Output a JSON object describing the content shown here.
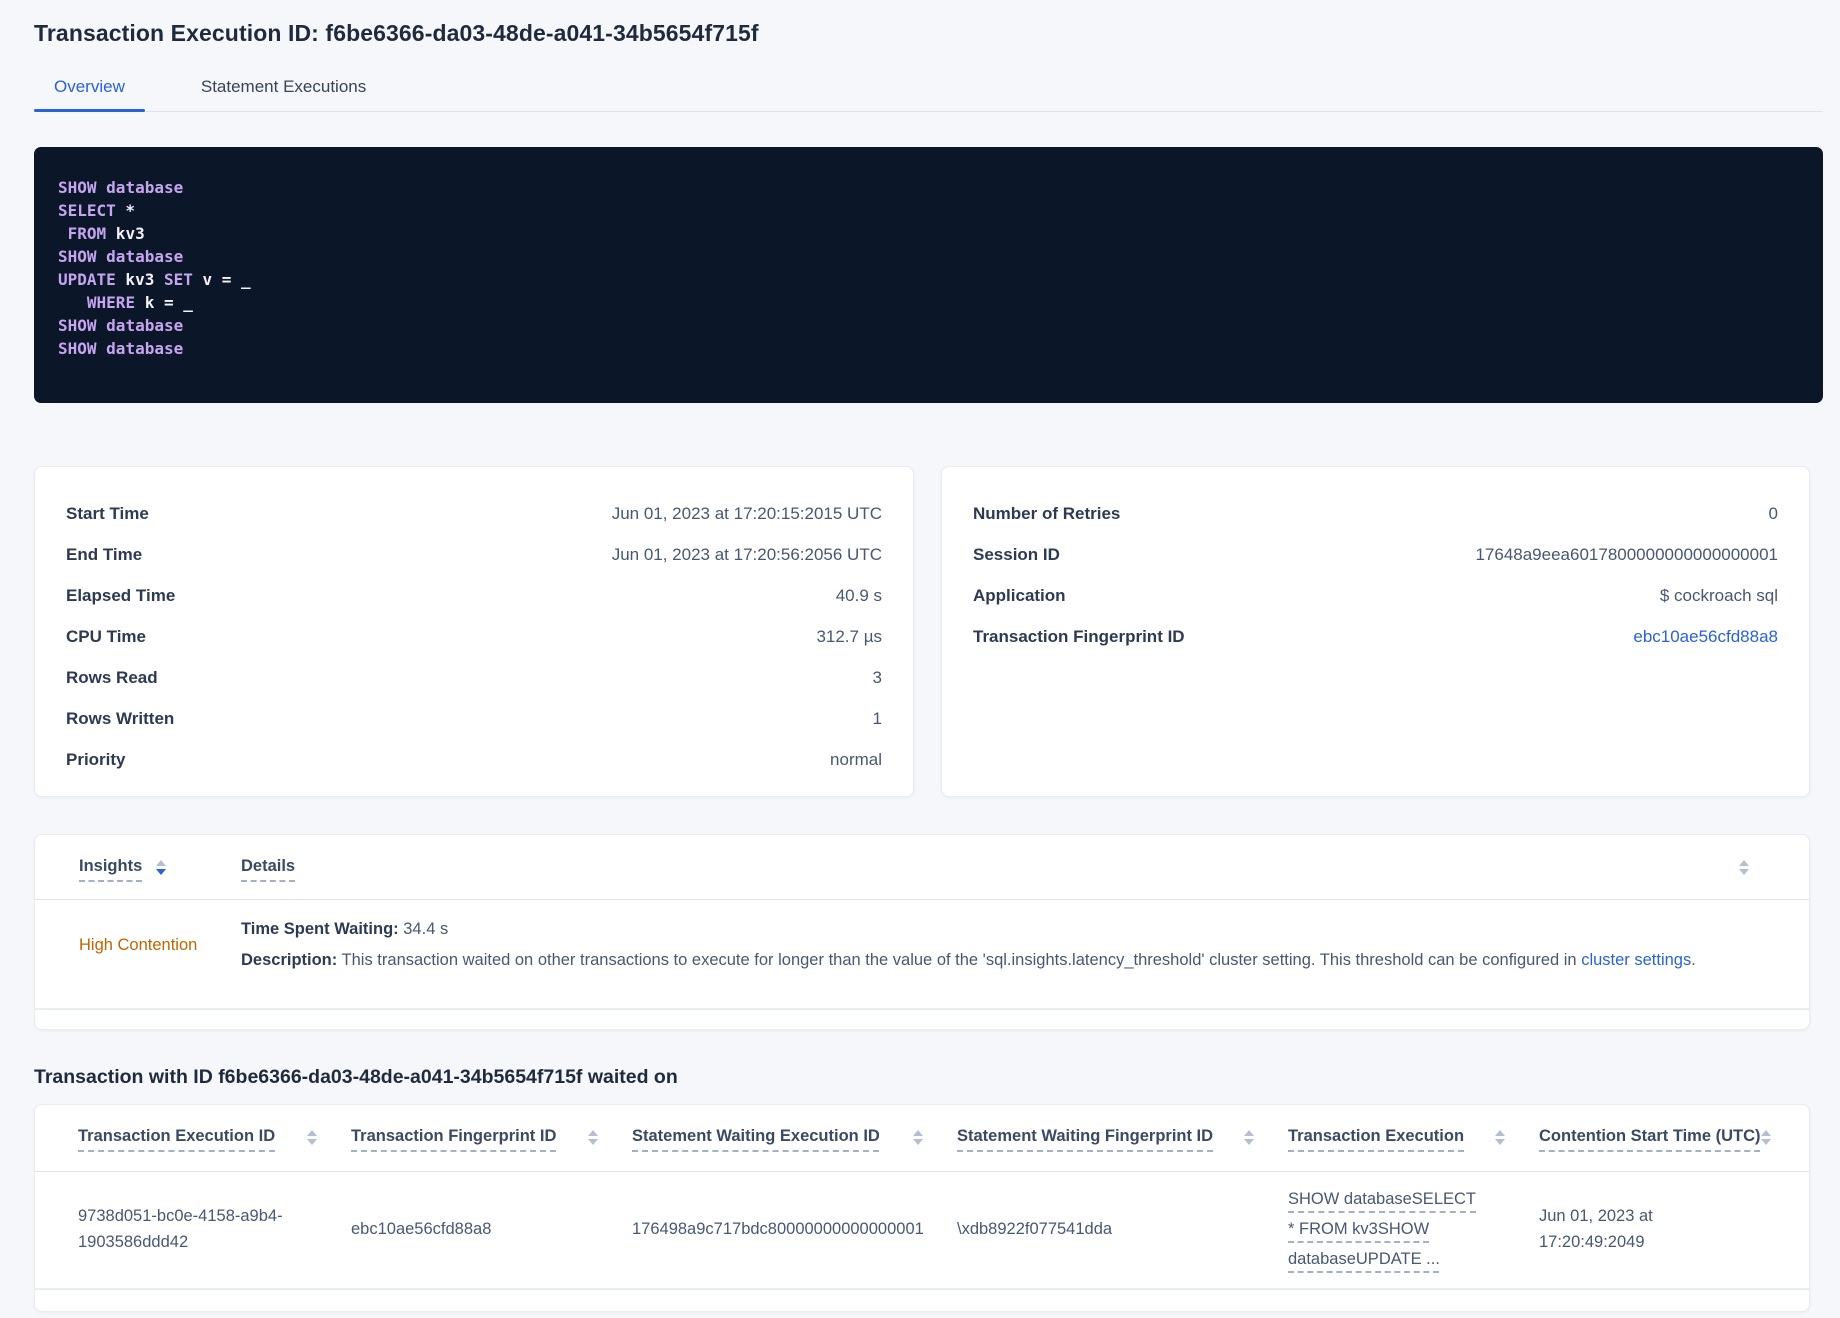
{
  "colors": {
    "accent_blue": "#2962d9",
    "sql_background": "#0c1629",
    "sql_keyword_purple": "#c5a5f0",
    "sql_text_white": "#f3f1fb",
    "warning_orange": "#c26400",
    "page_background": "#f5f7fa"
  },
  "header": {
    "title": "Transaction Execution ID: f6be6366-da03-48de-a041-34b5654f715f"
  },
  "tabs": [
    {
      "label": "Overview",
      "active": true
    },
    {
      "label": "Statement Executions",
      "active": false
    }
  ],
  "sql_box": {
    "lines": [
      [
        {
          "text": "SHOW",
          "kw": true
        },
        {
          "text": " "
        },
        {
          "text": "database",
          "kw": true
        }
      ],
      [
        {
          "text": "SELECT",
          "kw": true
        },
        {
          "text": " *"
        }
      ],
      [
        {
          "text": " "
        },
        {
          "text": "FROM",
          "kw": true
        },
        {
          "text": " kv3"
        }
      ],
      [
        {
          "text": "SHOW",
          "kw": true
        },
        {
          "text": " "
        },
        {
          "text": "database",
          "kw": true
        }
      ],
      [
        {
          "text": "UPDATE",
          "kw": true
        },
        {
          "text": " kv3 "
        },
        {
          "text": "SET",
          "kw": true
        },
        {
          "text": " v = _"
        }
      ],
      [
        {
          "text": "   "
        },
        {
          "text": "WHERE",
          "kw": true
        },
        {
          "text": " k = _"
        }
      ],
      [
        {
          "text": "SHOW",
          "kw": true
        },
        {
          "text": " "
        },
        {
          "text": "database",
          "kw": true
        }
      ],
      [
        {
          "text": "SHOW",
          "kw": true
        },
        {
          "text": " "
        },
        {
          "text": "database",
          "kw": true
        }
      ]
    ]
  },
  "summary_cards": {
    "left": {
      "rows": [
        {
          "label": "Start Time",
          "value": "Jun 01, 2023 at 17:20:15:2015 UTC"
        },
        {
          "label": "End Time",
          "value": "Jun 01, 2023 at 17:20:56:2056 UTC"
        },
        {
          "label": "Elapsed Time",
          "value": "40.9 s"
        },
        {
          "label": "CPU Time",
          "value": "312.7 µs"
        },
        {
          "label": "Rows Read",
          "value": "3"
        },
        {
          "label": "Rows Written",
          "value": "1"
        },
        {
          "label": "Priority",
          "value": "normal"
        }
      ]
    },
    "right": {
      "rows": [
        {
          "label": "Number of Retries",
          "value": "0"
        },
        {
          "label": "Session ID",
          "value": "17648a9eea6017800000000000000001"
        },
        {
          "label": "Application",
          "value": "$ cockroach sql"
        },
        {
          "label": "Transaction Fingerprint ID",
          "value": "ebc10ae56cfd88a8",
          "link": true
        }
      ]
    }
  },
  "insights_table": {
    "col1": "Insights",
    "col2": "Details",
    "row": {
      "insight": "High Contention",
      "waiting_label": "Time Spent Waiting:",
      "waiting_value": " 34.4 s",
      "desc_label": "Description:",
      "desc_text": " This transaction waited on other transactions to execute for longer than the value of the 'sql.insights.latency_threshold' cluster setting. This threshold can be configured in ",
      "desc_link": "cluster settings",
      "desc_end": "."
    }
  },
  "waited_section": {
    "heading": "Transaction with ID f6be6366-da03-48de-a041-34b5654f715f waited on",
    "columns": [
      "Transaction Execution ID",
      "Transaction Fingerprint ID",
      "Statement Waiting Execution ID",
      "Statement Waiting Fingerprint ID",
      "Transaction Execution",
      "Contention Start Time (UTC)"
    ],
    "row_cells": [
      "9738d051-bc0e-4158-a9b4-1903586ddd42",
      "ebc10ae56cfd88a8",
      "176498a9c717bdc80000000000000001",
      "\\xdb8922f077541dda",
      "SHOW databaseSELECT * FROM kv3SHOW databaseUPDATE ...",
      "Jun 01, 2023 at 17:20:49:2049"
    ],
    "exec_cell_index": 4
  }
}
